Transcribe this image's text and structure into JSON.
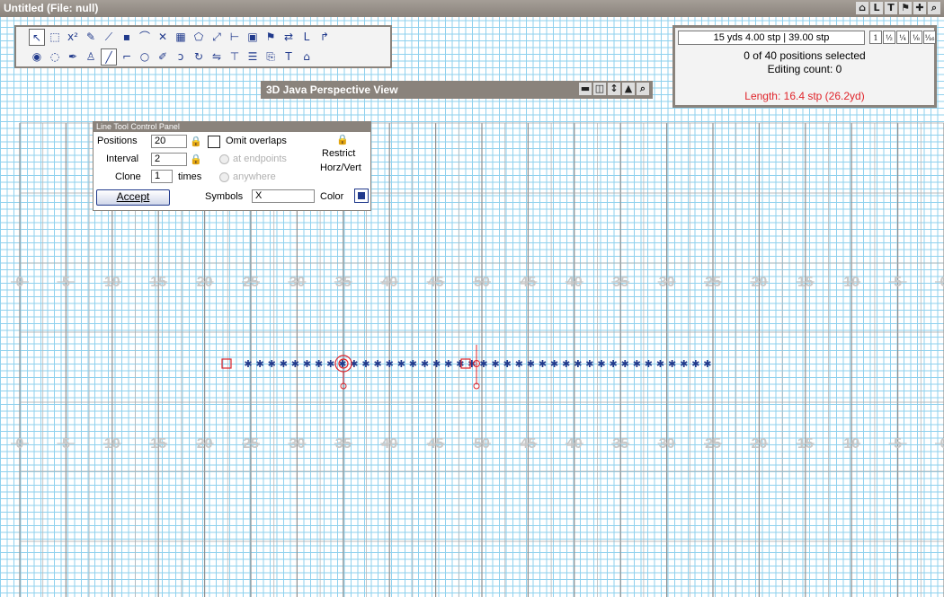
{
  "window": {
    "title": "Untitled  (File: null)",
    "title_icons": [
      "home-icon",
      "L",
      "T",
      "flag-icon",
      "move-icon",
      "zoom-icon"
    ]
  },
  "toolbar": {
    "row1": [
      "pointer-icon",
      "marquee-icon",
      "x2-icon",
      "pencil-icon",
      "knife-icon",
      "dot-icon",
      "arc-icon",
      "cross-icon",
      "grid-icon",
      "polygon-icon",
      "diagonal-icon",
      "steps-icon",
      "box-icon",
      "flag-icon",
      "swap-icon",
      "L",
      "arrow-icon"
    ],
    "row2": [
      "target-icon",
      "lasso-icon",
      "pen-icon",
      "person-icon",
      "line-icon",
      "curve-icon",
      "circle-icon",
      "draw-icon",
      "spiral-icon",
      "rotate-icon",
      "flip-icon",
      "down-icon",
      "stack-icon",
      "split-icon",
      "T",
      "house-icon"
    ]
  },
  "perspective": {
    "title": "3D Java Perspective View"
  },
  "status": {
    "step_display": "15 yds 4.00 stp | 39.00 stp",
    "fractions": [
      "1",
      "½",
      "¼",
      "⅛",
      "⅟₁₆"
    ],
    "selected": "0 of 40 positions selected",
    "editing": "Editing count: 0",
    "length": "Length: 16.4 stp (26.2yd)",
    "length_color": "#e0242a"
  },
  "line_panel": {
    "title": "Line Tool Control Panel",
    "positions_label": "Positions",
    "positions_value": "20",
    "interval_label": "Interval",
    "interval_value": "2",
    "clone_label": "Clone",
    "clone_value": "1",
    "times_label": "times",
    "omit_label": "Omit overlaps",
    "at_endpoints_label": "at endpoints",
    "anywhere_label": "anywhere",
    "restrict_label": "Restrict",
    "horzvert_label": "Horz/Vert",
    "accept_label": "Accept",
    "symbols_label": "Symbols",
    "symbols_value": "X",
    "color_label": "Color",
    "color_value": "#213a8c"
  },
  "field": {
    "yard_labels": [
      "0",
      "5",
      "10",
      "15",
      "20",
      "25",
      "30",
      "35",
      "40",
      "45",
      "50",
      "45",
      "40",
      "35",
      "30",
      "25",
      "20",
      "15",
      "10",
      "5",
      "0"
    ],
    "accent": "#213a8c",
    "marker_color": "#e0242a"
  }
}
